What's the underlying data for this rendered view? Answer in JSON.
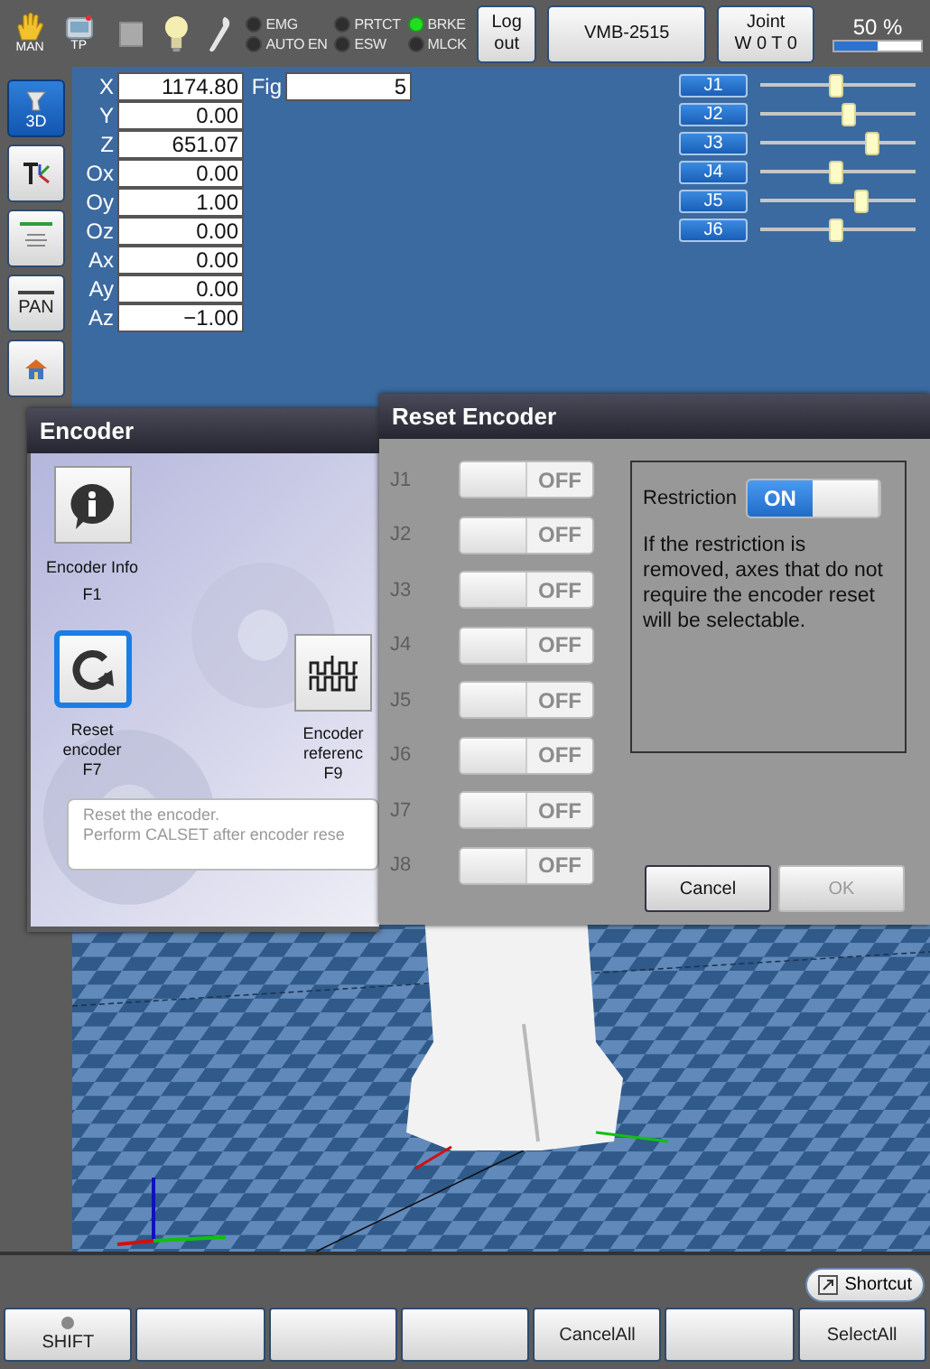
{
  "status_bar": {
    "mode": "MAN",
    "pendant": "TP",
    "lamps": [
      {
        "label": "EMG",
        "on": false
      },
      {
        "label": "AUTO EN",
        "on": false
      },
      {
        "label": "PRTCT",
        "on": false
      },
      {
        "label": "ESW",
        "on": false
      },
      {
        "label": "BRKE",
        "on": true
      },
      {
        "label": "MLCK",
        "on": false
      }
    ],
    "logout": "Log out",
    "robot": "VMB-2515",
    "coord": "Joint",
    "tool": "W 0 T 0",
    "speed": {
      "text": "50 %",
      "level": 0.5
    }
  },
  "toolbar": [
    {
      "kind": "view3d",
      "label": "3D",
      "selected": true
    },
    {
      "kind": "tool",
      "selected": false
    },
    {
      "kind": "list",
      "selected": false
    },
    {
      "kind": "pan",
      "label": "PAN",
      "selected": false
    },
    {
      "kind": "home",
      "selected": false
    }
  ],
  "position": [
    {
      "label": "X",
      "value": "1174.80"
    },
    {
      "label": "Y",
      "value": "0.00"
    },
    {
      "label": "Z",
      "value": "651.07"
    },
    {
      "label": "Ox",
      "value": "0.00"
    },
    {
      "label": "Oy",
      "value": "1.00"
    },
    {
      "label": "Oz",
      "value": "0.00"
    },
    {
      "label": "Ax",
      "value": "0.00"
    },
    {
      "label": "Ay",
      "value": "0.00"
    },
    {
      "label": "Az",
      "value": "−1.00"
    }
  ],
  "fig": {
    "label": "Fig",
    "value": "5"
  },
  "jog": [
    {
      "label": "J1",
      "level": 0.49
    },
    {
      "label": "J2",
      "level": 0.57
    },
    {
      "label": "J3",
      "level": 0.72
    },
    {
      "label": "J4",
      "level": 0.49
    },
    {
      "label": "J5",
      "level": 0.65
    },
    {
      "label": "J6",
      "level": 0.49
    }
  ],
  "encoder_dialog": {
    "title": "Encoder",
    "items": [
      {
        "kind": "info",
        "label": "Encoder Info",
        "key": "F1",
        "selected": false
      },
      {
        "kind": "reset",
        "label": "Reset encoder",
        "key": "F7",
        "selected": true
      },
      {
        "kind": "reference",
        "label": "Encoder referenc",
        "key": "F9",
        "selected": false
      }
    ],
    "description": [
      "Reset the encoder.",
      "Perform CALSET after encoder rese"
    ]
  },
  "reset_dialog": {
    "title": "Reset Encoder",
    "axes": [
      {
        "label": "J1",
        "toggle": "OFF",
        "on": false,
        "disabled": true
      },
      {
        "label": "J2",
        "toggle": "OFF",
        "on": false,
        "disabled": true
      },
      {
        "label": "J3",
        "toggle": "OFF",
        "on": false,
        "disabled": true
      },
      {
        "label": "J4",
        "toggle": "OFF",
        "on": false,
        "disabled": true
      },
      {
        "label": "J5",
        "toggle": "OFF",
        "on": false,
        "disabled": true
      },
      {
        "label": "J6",
        "toggle": "OFF",
        "on": false,
        "disabled": true
      },
      {
        "label": "J7",
        "toggle": "OFF",
        "on": false,
        "disabled": true
      },
      {
        "label": "J8",
        "toggle": "OFF",
        "on": false,
        "disabled": true
      }
    ],
    "restriction": {
      "label": "Restriction",
      "toggle": "ON",
      "on": true
    },
    "note": "If the restriction is removed, axes that do not require the encoder reset will be selectable.",
    "buttons": [
      {
        "label": "Cancel",
        "disabled": false
      },
      {
        "label": "OK",
        "disabled": true
      }
    ]
  },
  "shortcut": "Shortcut",
  "function_keys": [
    {
      "kind": "lamp",
      "label": "SHIFT",
      "on": false
    },
    {
      "kind": "blank"
    },
    {
      "kind": "blank"
    },
    {
      "kind": "blank"
    },
    {
      "kind": "text",
      "label": "CancelAll"
    },
    {
      "kind": "blank"
    },
    {
      "kind": "text",
      "label": "SelectAll"
    }
  ]
}
